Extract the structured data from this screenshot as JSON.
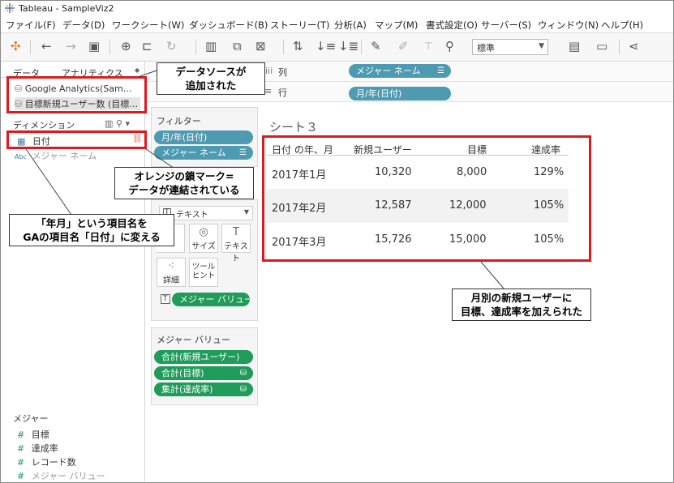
{
  "window": {
    "title": "Tableau - SampleViz2"
  },
  "menu": [
    "ファイル(F)",
    "データ(D)",
    "ワークシート(W)",
    "ダッシュボード(B)",
    "ストーリー(T)",
    "分析(A)",
    "マップ(M)",
    "書式設定(O)",
    "サーバー(S)",
    "ウィンドウ(N)",
    "ヘルプ(H)"
  ],
  "toolbar": {
    "fit": "標準",
    "icons": [
      "tableau-logo-icon",
      "back-icon",
      "forward-icon",
      "save-icon",
      "new-datasource-icon",
      "pause-icon",
      "refresh-icon",
      "new-sheet-icon",
      "duplicate-icon",
      "clear-icon",
      "swap-icon",
      "sort-asc-icon",
      "sort-desc-icon",
      "highlight-icon",
      "pen-icon",
      "label-icon",
      "pin-icon",
      "show-me-icon",
      "presentation-icon",
      "share-icon"
    ]
  },
  "datapane": {
    "tab_data": "データ",
    "tab_analytics": "アナリティクス",
    "datasources": [
      "Google Analytics(Sam…",
      "目標新規ユーザー数 (目標…"
    ],
    "dimensions_header": "ディメンション",
    "dimensions": [
      {
        "label": "日付",
        "icon": "calendar-icon",
        "linked": true
      },
      {
        "label": "メジャー ネーム",
        "icon": "abc-icon",
        "linked": false,
        "muted": true
      }
    ],
    "measures_header": "メジャー",
    "measures": [
      {
        "label": "目標",
        "muted": false
      },
      {
        "label": "達成率",
        "muted": false
      },
      {
        "label": "レコード数",
        "muted": false
      },
      {
        "label": "メジャー バリュー",
        "muted": true
      }
    ]
  },
  "shelves": {
    "columns_label": "列",
    "columns_pill": "メジャー ネーム",
    "rows_label": "行",
    "rows_pill": "月/年(日付)"
  },
  "filters": {
    "title": "フィルター",
    "items": [
      "月/年(日付)",
      "メジャー ネーム"
    ]
  },
  "marks": {
    "type": "テキスト",
    "buttons": [
      {
        "label": "サイズ",
        "icon": "size-icon"
      },
      {
        "label": "テキスト",
        "icon": "text-icon"
      },
      {
        "label": "詳細",
        "icon": "detail-icon"
      },
      {
        "label": "ツール\nヒント",
        "icon": "tooltip-icon"
      }
    ],
    "text_pill": "メジャー バリュー"
  },
  "measure_values": {
    "title": "メジャー バリュー",
    "items": [
      "合計(新規ユーザー)",
      "合計(目標)",
      "集計(達成率)"
    ]
  },
  "sheet": {
    "title": "シート３",
    "columns": [
      "日付 の年、月",
      "新規ユーザー",
      "目標",
      "達成率"
    ],
    "rows": [
      [
        "2017年1月",
        "10,320",
        "8,000",
        "129%"
      ],
      [
        "2017年2月",
        "12,587",
        "12,000",
        "105%"
      ],
      [
        "2017年3月",
        "15,726",
        "15,000",
        "105%"
      ]
    ]
  },
  "callouts": {
    "datasource": [
      "データソースが",
      "追加された"
    ],
    "chain": [
      "オレンジの鎖マーク=",
      "データが連結されている"
    ],
    "rename": [
      "「年月」という項目名を",
      "GAの項目名「日付」に変える"
    ],
    "table": [
      "月別の新規ユーザーに",
      "目標、達成率を加えられた"
    ]
  },
  "colors": {
    "accent_red": "#e0191f",
    "pill_blue": "#4e9ab1",
    "pill_green": "#1f9c5a",
    "link_orange": "#e46c4c"
  }
}
